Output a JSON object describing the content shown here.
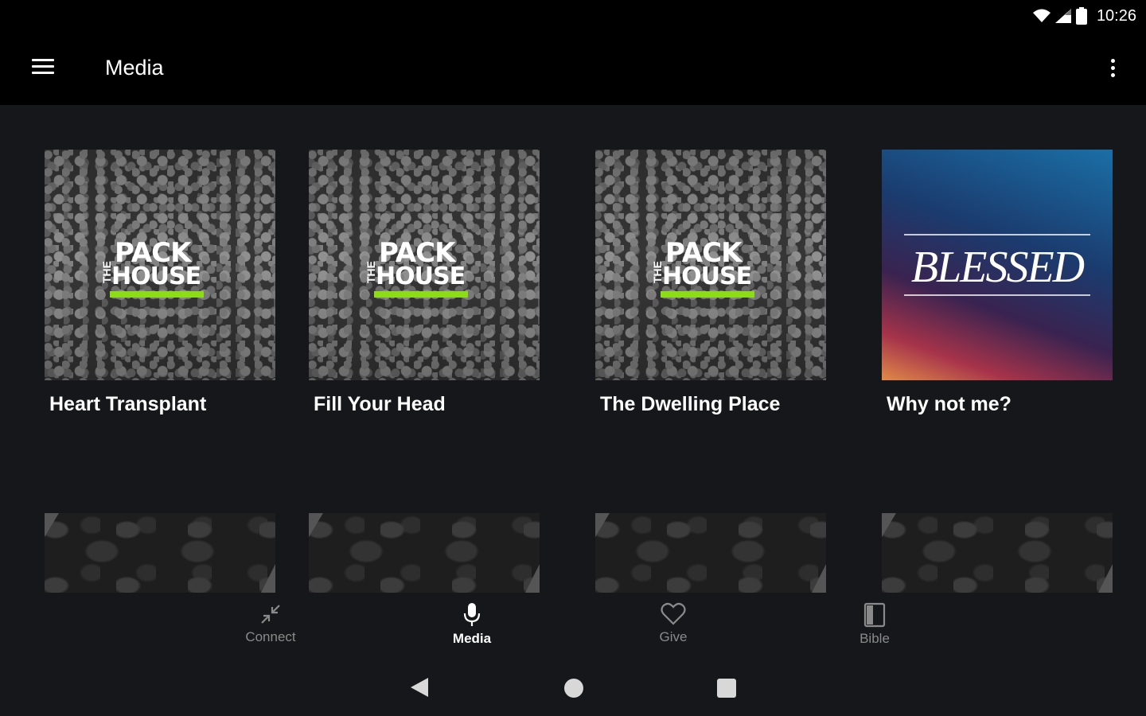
{
  "status_bar": {
    "time": "10:26",
    "icons": [
      "wifi-icon",
      "signal-icon",
      "battery-icon"
    ]
  },
  "app_bar": {
    "title": "Media",
    "menu_icon": "hamburger-menu-icon",
    "overflow_icon": "more-vert-icon"
  },
  "media_items": [
    {
      "title": "Heart Transplant",
      "art": "pack-the-house",
      "art_text": {
        "the": "THE",
        "pack": "PACK",
        "house": "HOUSE"
      }
    },
    {
      "title": "Fill Your Head",
      "art": "pack-the-house",
      "art_text": {
        "the": "THE",
        "pack": "PACK",
        "house": "HOUSE"
      }
    },
    {
      "title": "The Dwelling Place",
      "art": "pack-the-house",
      "art_text": {
        "the": "THE",
        "pack": "PACK",
        "house": "HOUSE"
      }
    },
    {
      "title": "Why not me?",
      "art": "blessed",
      "art_text": {
        "word": "BLESSED"
      }
    }
  ],
  "bottom_nav": {
    "items": [
      {
        "label": "Connect",
        "icon": "connect-arrows-icon",
        "active": false
      },
      {
        "label": "Media",
        "icon": "microphone-icon",
        "active": true
      },
      {
        "label": "Give",
        "icon": "heart-icon",
        "active": false
      },
      {
        "label": "Bible",
        "icon": "book-icon",
        "active": false
      }
    ]
  },
  "system_nav": {
    "icons": [
      "back-icon",
      "home-icon",
      "recents-icon"
    ]
  },
  "colors": {
    "background": "#16171a",
    "bar": "#000000",
    "accent_green": "#8ddc18",
    "inactive_label": "#8a8a8a"
  }
}
